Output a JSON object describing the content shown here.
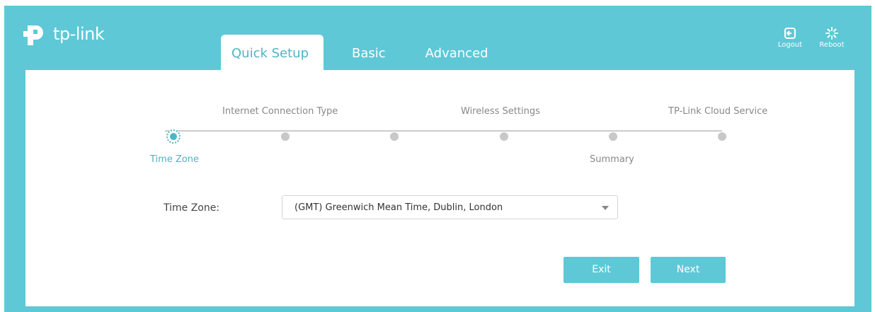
{
  "brand": {
    "name": "tp-link",
    "logo_icon": "tp-link-logo-icon"
  },
  "tabs": [
    {
      "label": "Quick Setup",
      "active": true
    },
    {
      "label": "Basic",
      "active": false
    },
    {
      "label": "Advanced",
      "active": false
    }
  ],
  "header_actions": {
    "logout": {
      "label": "Logout",
      "icon": "logout-icon"
    },
    "reboot": {
      "label": "Reboot",
      "icon": "reboot-icon"
    }
  },
  "wizard": {
    "steps": [
      {
        "label": "Time Zone",
        "active": true
      },
      {
        "label": "Internet Connection Type",
        "active": false
      },
      {
        "label": "Wireless Settings",
        "active": false
      },
      {
        "label": "Wireless Settings",
        "active": false
      },
      {
        "label": "Summary",
        "active": false
      },
      {
        "label": "TP-Link Cloud Service",
        "active": false
      }
    ],
    "labels": {
      "time_zone": "Time Zone",
      "internet_connection_type": "Internet Connection Type",
      "wireless_settings": "Wireless Settings",
      "summary": "Summary",
      "cloud_service": "TP-Link Cloud Service"
    }
  },
  "form": {
    "time_zone_label": "Time Zone:",
    "time_zone_value": "(GMT) Greenwich Mean Time, Dublin, London"
  },
  "buttons": {
    "exit": "Exit",
    "next": "Next"
  },
  "colors": {
    "accent": "#5ec8d6",
    "active_text": "#4fb4c6",
    "dot_inactive": "#c8c8c8"
  }
}
